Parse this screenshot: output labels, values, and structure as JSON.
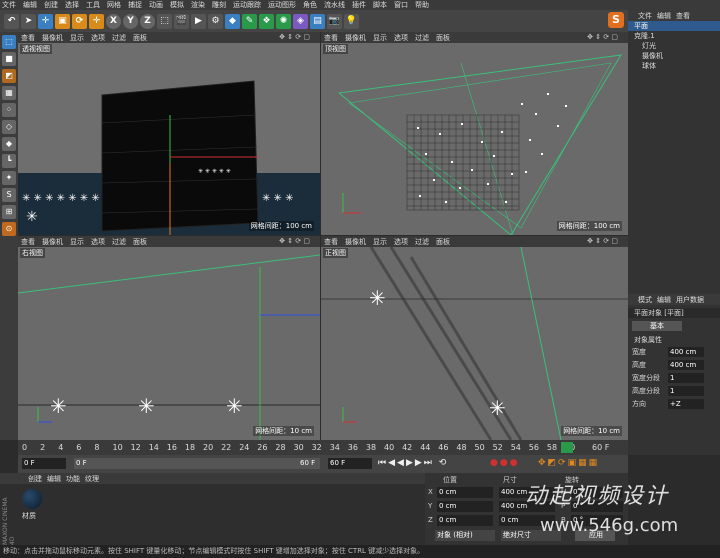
{
  "menubar": [
    "文件",
    "编辑",
    "创建",
    "选择",
    "工具",
    "网格",
    "捕捉",
    "动画",
    "模拟",
    "渲染",
    "雕刻",
    "运动跟踪",
    "运动图形",
    "角色",
    "流水线",
    "插件",
    "脚本",
    "窗口",
    "帮助"
  ],
  "toolbar": {
    "axis_x": "X",
    "axis_y": "Y",
    "axis_z": "Z"
  },
  "viewports": {
    "perspective": {
      "menu": [
        "查看",
        "摄像机",
        "显示",
        "选项",
        "过滤",
        "面板"
      ],
      "label": "透视视图",
      "grid": "网格间距：100 cm"
    },
    "top": {
      "menu": [
        "查看",
        "摄像机",
        "显示",
        "选项",
        "过滤",
        "面板"
      ],
      "label": "顶视图",
      "grid": "网格间距：100 cm"
    },
    "right": {
      "menu": [
        "查看",
        "摄像机",
        "显示",
        "选项",
        "过滤",
        "面板"
      ],
      "label": "右视图",
      "grid": "网格间距：10 cm"
    },
    "front": {
      "menu": [
        "查看",
        "摄像机",
        "显示",
        "选项",
        "过滤",
        "面板"
      ],
      "label": "正视图",
      "grid": "网格间距：10 cm"
    }
  },
  "objects": {
    "menu": [
      "文件",
      "编辑",
      "查看"
    ],
    "items": [
      {
        "name": "平面",
        "selected": true
      },
      {
        "name": "克隆.1",
        "selected": false
      },
      {
        "name": "灯光",
        "selected": false
      },
      {
        "name": "摄像机",
        "selected": false
      },
      {
        "name": "球体",
        "selected": false
      }
    ]
  },
  "attributes": {
    "menu": [
      "模式",
      "编辑",
      "用户数据"
    ],
    "object_label": "平面对象 [平面]",
    "tab": "基本",
    "section": "对象属性",
    "rows": [
      {
        "label": "宽度",
        "value": "400 cm"
      },
      {
        "label": "高度",
        "value": "400 cm"
      },
      {
        "label": "宽度分段",
        "value": "1"
      },
      {
        "label": "高度分段",
        "value": "1"
      },
      {
        "label": "方向",
        "value": "+Z"
      }
    ]
  },
  "timeline": {
    "ticks": [
      "0",
      "2",
      "4",
      "6",
      "8",
      "10",
      "12",
      "14",
      "16",
      "18",
      "20",
      "22",
      "24",
      "26",
      "28",
      "30",
      "32",
      "34",
      "36",
      "38",
      "40",
      "42",
      "44",
      "46",
      "48",
      "50",
      "52",
      "54",
      "56",
      "58",
      "60"
    ],
    "end_label": "60 F"
  },
  "transport": {
    "start": "0 F",
    "current": "0 F",
    "end_a": "60 F",
    "end_b": "60 F"
  },
  "materials": {
    "menu": [
      "创建",
      "编辑",
      "功能",
      "纹理"
    ],
    "material_name": "材质"
  },
  "coordinates": {
    "headers": [
      "位置",
      "尺寸",
      "旋转"
    ],
    "rows": [
      {
        "axis": "X",
        "pos": "0 cm",
        "size": "400 cm",
        "rot_axis": "H",
        "rot": "0 °"
      },
      {
        "axis": "Y",
        "pos": "0 cm",
        "size": "400 cm",
        "rot_axis": "P",
        "rot": "0 °"
      },
      {
        "axis": "Z",
        "pos": "0 cm",
        "size": "0 cm",
        "rot_axis": "B",
        "rot": "0 °"
      }
    ],
    "mode_a": "对象 (相对)",
    "mode_b": "绝对尺寸",
    "apply": "应用"
  },
  "status": "移动：点击并拖动鼠标移动元素。按住 SHIFT 键量化移动；节点编辑模式时按住 SHIFT 键增加选择对象；按住 CTRL 键减少选择对象。",
  "watermark": {
    "line1": "动起视频设计",
    "line2": "www.546g.com"
  }
}
